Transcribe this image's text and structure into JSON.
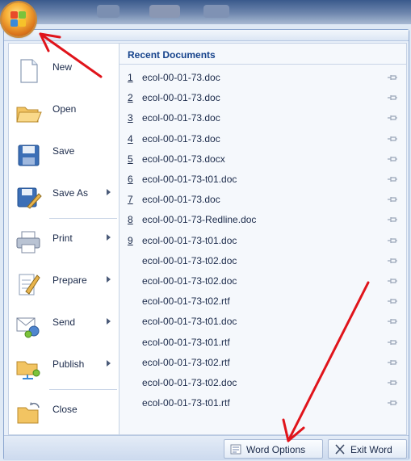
{
  "left_menu": [
    {
      "label": "New",
      "icon": "new-document-icon",
      "has_submenu": false
    },
    {
      "label": "Open",
      "icon": "open-folder-icon",
      "has_submenu": false
    },
    {
      "label": "Save",
      "icon": "save-disk-icon",
      "has_submenu": false
    },
    {
      "label": "Save As",
      "icon": "save-as-icon",
      "has_submenu": true
    },
    {
      "label": "Print",
      "icon": "printer-icon",
      "has_submenu": true
    },
    {
      "label": "Prepare",
      "icon": "prepare-icon",
      "has_submenu": true
    },
    {
      "label": "Send",
      "icon": "send-icon",
      "has_submenu": true
    },
    {
      "label": "Publish",
      "icon": "publish-icon",
      "has_submenu": true
    },
    {
      "label": "Close",
      "icon": "close-folder-icon",
      "has_submenu": false
    }
  ],
  "recent": {
    "header": "Recent Documents",
    "items": [
      {
        "num": "1",
        "name": "ecol-00-01-73.doc"
      },
      {
        "num": "2",
        "name": "ecol-00-01-73.doc"
      },
      {
        "num": "3",
        "name": "ecol-00-01-73.doc"
      },
      {
        "num": "4",
        "name": "ecol-00-01-73.doc"
      },
      {
        "num": "5",
        "name": "ecol-00-01-73.docx"
      },
      {
        "num": "6",
        "name": "ecol-00-01-73-t01.doc"
      },
      {
        "num": "7",
        "name": "ecol-00-01-73.doc"
      },
      {
        "num": "8",
        "name": "ecol-00-01-73-Redline.doc"
      },
      {
        "num": "9",
        "name": "ecol-00-01-73-t01.doc"
      },
      {
        "num": "",
        "name": "ecol-00-01-73-t02.doc"
      },
      {
        "num": "",
        "name": "ecol-00-01-73-t02.doc"
      },
      {
        "num": "",
        "name": "ecol-00-01-73-t02.rtf"
      },
      {
        "num": "",
        "name": "ecol-00-01-73-t01.doc"
      },
      {
        "num": "",
        "name": "ecol-00-01-73-t01.rtf"
      },
      {
        "num": "",
        "name": "ecol-00-01-73-t02.rtf"
      },
      {
        "num": "",
        "name": "ecol-00-01-73-t02.doc"
      },
      {
        "num": "",
        "name": "ecol-00-01-73-t01.rtf"
      }
    ]
  },
  "buttons": {
    "word_options": "Word Options",
    "exit_word": "Exit Word"
  },
  "colors": {
    "annotation_arrow": "#e0141b",
    "office_orb": "#f0a030"
  }
}
